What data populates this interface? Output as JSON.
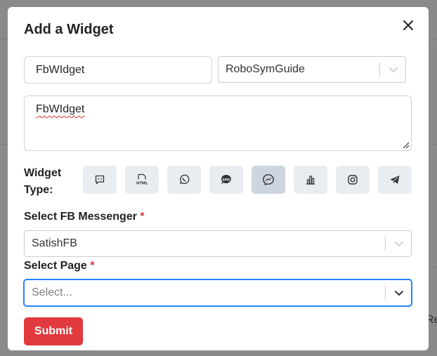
{
  "modal": {
    "title": "Add a Widget",
    "close_icon": "close-icon"
  },
  "form": {
    "name_value": "FbWIdget",
    "guide_select": {
      "value": "RoboSymGuide"
    },
    "description_value": "FbWIdget",
    "widget_type": {
      "label": "Widget Type:",
      "options": [
        {
          "icon": "chat-icon",
          "active": false
        },
        {
          "icon": "html-file-icon",
          "active": false
        },
        {
          "icon": "whatsapp-icon",
          "active": false
        },
        {
          "icon": "sms-icon",
          "active": false
        },
        {
          "icon": "messenger-icon",
          "active": true
        },
        {
          "icon": "bar-chart-icon",
          "active": false
        },
        {
          "icon": "instagram-icon",
          "active": false
        },
        {
          "icon": "telegram-icon",
          "active": false
        }
      ]
    },
    "fb_messenger": {
      "label": "Select FB Messenger",
      "required_mark": "*",
      "value": "SatishFB"
    },
    "page_select": {
      "label": "Select Page",
      "required_mark": "*",
      "placeholder": "Select..."
    },
    "submit_label": "Submit"
  },
  "background": {
    "partial_text": "Re"
  },
  "colors": {
    "overlay": "#8a8a8a",
    "submit": "#e0393e",
    "required": "#dc3545",
    "focus_border": "#2684ff",
    "active_type": "#cdd5e0"
  }
}
